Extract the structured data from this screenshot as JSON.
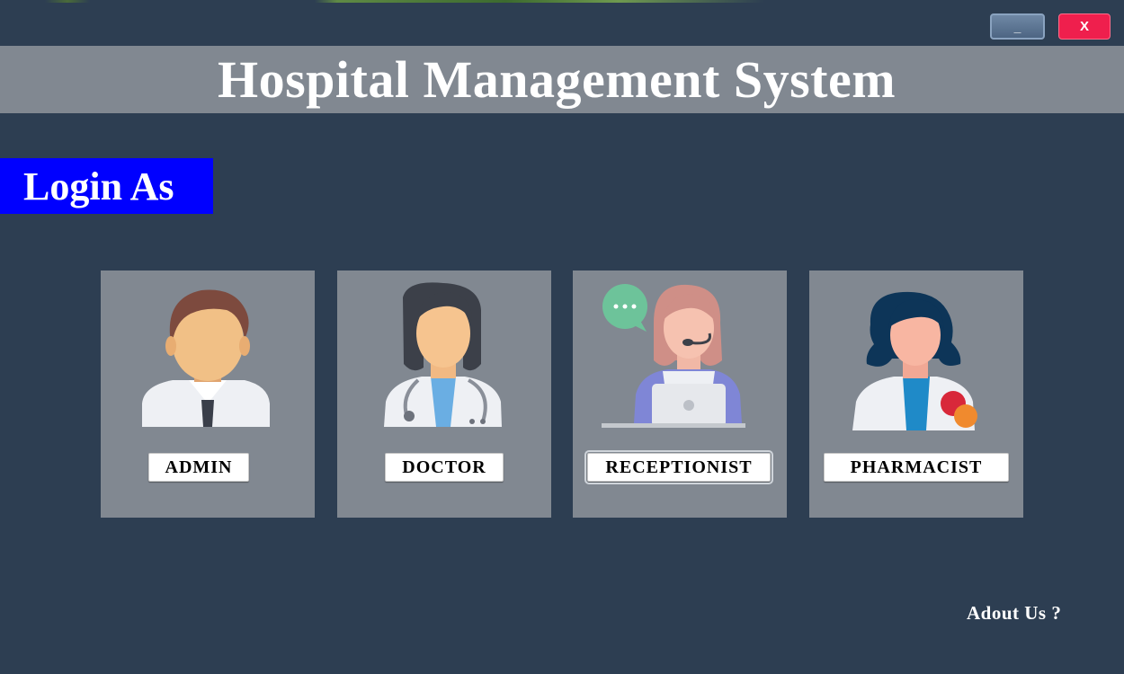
{
  "window": {
    "minimize_label": "_",
    "close_label": "X"
  },
  "header": {
    "title": "Hospital Management System"
  },
  "login": {
    "heading": "Login As"
  },
  "roles": [
    {
      "label": "ADMIN",
      "icon": "admin-avatar-icon"
    },
    {
      "label": "DOCTOR",
      "icon": "doctor-avatar-icon"
    },
    {
      "label": "RECEPTIONIST",
      "icon": "receptionist-avatar-icon"
    },
    {
      "label": "PHARMACIST",
      "icon": "pharmacist-avatar-icon"
    }
  ],
  "footer": {
    "about_link": "Adout Us ?"
  },
  "colors": {
    "background": "#2d3e52",
    "panel": "#818891",
    "login_badge": "#0000ff",
    "close_button": "#ef1f4d"
  }
}
